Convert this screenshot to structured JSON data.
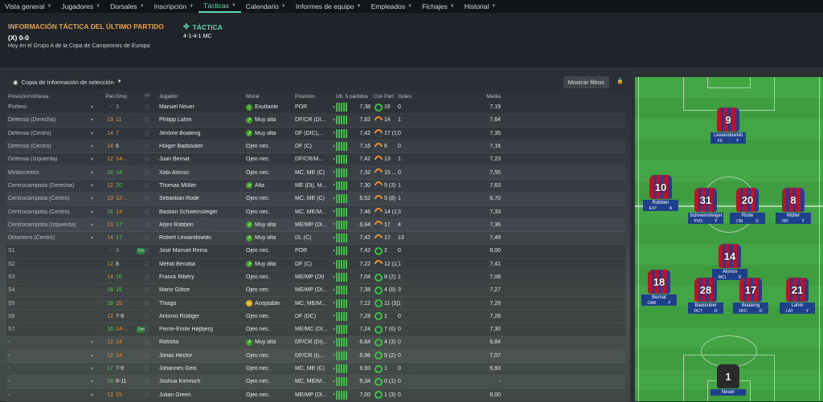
{
  "menu": [
    "Vista general",
    "Jugadores",
    "Dorsales",
    "Inscripción",
    "Tácticas",
    "Calendario",
    "Informes de equipo",
    "Empleados",
    "Fichajes",
    "Historial"
  ],
  "menu_active": 4,
  "info": {
    "title": "INFORMACIÓN TÁCTICA DEL ÚLTIMO PARTIDO",
    "score": "(X) 0-0",
    "subtitle": "Hoy en el Grupo A de la Copa de Campeones de Europa",
    "tactic_title": "TÁCTICA",
    "formation": "4-1-4-1 MC"
  },
  "toolbar": {
    "view": "Copia de Información de selección",
    "show_filters": "Mostrar filtros"
  },
  "columns": {
    "pos": "Posición/rol/tarea",
    "pas": "Pas",
    "dmq": "Dmq",
    "inf": "Inf",
    "jugador": "Jugador",
    "moral": "Moral",
    "posicion": "Posición",
    "ult5": "Últ. 5 partidos",
    "con": "Con",
    "part": "Part",
    "goles": "Goles",
    "media": "Media"
  },
  "rows": [
    {
      "pos": "Portero",
      "pas": "-",
      "dmq": "3",
      "dmqc": "grey",
      "pasc": "grey",
      "name": "Manuel Neuer",
      "moral": "Exultante",
      "mi": "g",
      "mg": "↑",
      "posn": "POR",
      "bars": [
        5,
        5,
        5,
        5,
        5
      ],
      "ult": "7,38",
      "con": "full",
      "part": "16",
      "goles": "0",
      "media": "7,19"
    },
    {
      "pos": "Defensa (Derecha)",
      "pas": "13",
      "dmq": "11",
      "pasc": "orange",
      "dmqc": "orange",
      "name": "Philipp Lahm",
      "moral": "Muy alta",
      "mi": "g",
      "mg": "↗",
      "posn": "DF/CR (Dl...",
      "bars": [
        5,
        5,
        5,
        5,
        5
      ],
      "ult": "7,82",
      "con": "half",
      "part": "14",
      "goles": "1",
      "media": "7,64"
    },
    {
      "pos": "Defensa (Centro)",
      "pas": "14",
      "dmq": "7",
      "pasc": "orange",
      "dmqc": "orange",
      "name": "Jérôme Boateng",
      "moral": "Muy alta",
      "mi": "g",
      "mg": "↗",
      "posn": "DF (DIC),...",
      "bars": [
        5,
        5,
        5,
        5,
        5
      ],
      "ult": "7,42",
      "con": "half",
      "part": "17 (1)",
      "goles": "0",
      "media": "7,35"
    },
    {
      "pos": "Defensa (Centro)",
      "pas": "14",
      "dmq": "6",
      "pasc": "orange",
      "dmqc": "",
      "name": "Holger Badstuber",
      "moral": "Ojeo nec.",
      "mi": "",
      "mg": "",
      "posn": "DF (C)",
      "bars": [
        5,
        5,
        5,
        5,
        5
      ],
      "ult": "7,16",
      "con": "half",
      "part": "6",
      "goles": "0",
      "media": "7,16"
    },
    {
      "pos": "Defensa (Izquierda)",
      "pas": "12",
      "dmq": "14-...",
      "pasc": "orange",
      "dmqc": "orange",
      "name": "Juan Bernat",
      "moral": "Ojeo nec.",
      "mi": "",
      "mg": "",
      "posn": "DF/CR/M...",
      "bars": [
        5,
        5,
        5,
        5,
        5
      ],
      "ult": "7,42",
      "con": "half",
      "part": "13",
      "goles": "1",
      "media": "7,23"
    },
    {
      "pos": "Mediocentro",
      "pas": "18",
      "dmq": "14",
      "pasc": "green",
      "dmqc": "green",
      "name": "Xabi Alonso",
      "moral": "Ojeo nec.",
      "mi": "",
      "mg": "",
      "posn": "MC, ME (C)",
      "bars": [
        5,
        5,
        5,
        5,
        5
      ],
      "ult": "7,32",
      "con": "half",
      "part": "15 ...",
      "goles": "0",
      "media": "7,55"
    },
    {
      "pos": "Centrocampista (Derecha)",
      "pas": "12",
      "dmq": "20",
      "pasc": "orange",
      "dmqc": "green",
      "name": "Thomas Müller",
      "moral": "Alta",
      "mi": "g",
      "mg": "↗",
      "posn": "ME (Dl), M...",
      "bars": [
        5,
        5,
        5,
        5,
        5
      ],
      "ult": "7,30",
      "con": "half",
      "part": "5 (3)",
      "goles": "1",
      "media": "7,63"
    },
    {
      "pos": "Centrocampista (Centro)",
      "pas": "13",
      "dmq": "12-...",
      "pasc": "orange",
      "dmqc": "orange",
      "name": "Sebastian Rode",
      "moral": "Ojeo nec.",
      "mi": "",
      "mg": "",
      "posn": "MC, ME (C)",
      "bars": [
        5,
        5,
        5,
        5,
        5
      ],
      "ult": "6,52",
      "con": "half",
      "part": "5 (8)",
      "goles": "1",
      "media": "6,70"
    },
    {
      "pos": "Centrocampista (Centro)",
      "pas": "16",
      "dmq": "13",
      "pasc": "green",
      "dmqc": "orange",
      "name": "Bastian Schweinsteiger",
      "moral": "Ojeo nec.",
      "mi": "",
      "mg": "",
      "posn": "MC, ME/M...",
      "bars": [
        5,
        5,
        5,
        5,
        5
      ],
      "ult": "7,46",
      "con": "half",
      "part": "14 (1)",
      "goles": "3",
      "media": "7,33"
    },
    {
      "pos": "Centrocampista (Izquierda)",
      "pas": "13",
      "dmq": "17",
      "pasc": "orange",
      "dmqc": "green",
      "name": "Arjen Robben",
      "moral": "Muy alta",
      "mi": "g",
      "mg": "↗",
      "posn": "ME/MP (Dl...",
      "bars": [
        5,
        5,
        5,
        5,
        5
      ],
      "ult": "6,94",
      "con": "half",
      "part": "17",
      "goles": "4",
      "media": "7,36"
    },
    {
      "pos": "Delantero (Centro)",
      "pas": "14",
      "dmq": "17",
      "pasc": "orange",
      "dmqc": "green",
      "name": "Robert Lewandowski",
      "moral": "Muy alta",
      "mi": "g",
      "mg": "↗",
      "posn": "DL (C)",
      "bars": [
        5,
        5,
        5,
        5,
        5
      ],
      "ult": "7,42",
      "con": "half",
      "part": "17",
      "goles": "13",
      "media": "7,49"
    },
    {
      "pos": "S1",
      "pas": "-",
      "dmq": "3",
      "pasc": "grey",
      "dmqc": "grey",
      "den": true,
      "name": "José Manuel Reina",
      "moral": "Ojeo nec.",
      "mi": "",
      "mg": "",
      "posn": "POR",
      "bars": [
        5,
        5,
        5,
        5,
        5
      ],
      "ult": "7,42",
      "con": "full",
      "part": "2",
      "goles": "0",
      "media": "8,00"
    },
    {
      "pos": "S2",
      "pas": "12",
      "dmq": "8",
      "pasc": "orange",
      "dmqc": "",
      "name": "Mehdi Benatia",
      "moral": "Muy alta",
      "mi": "g",
      "mg": "↗",
      "posn": "DF (C)",
      "bars": [
        5,
        5,
        5,
        5,
        5
      ],
      "ult": "7,22",
      "con": "half",
      "part": "12 (1)",
      "goles": "1",
      "media": "7,41"
    },
    {
      "pos": "S3",
      "pas": "14",
      "dmq": "16",
      "pasc": "orange",
      "dmqc": "green",
      "name": "Franck Ribéry",
      "moral": "Ojeo nec.",
      "mi": "",
      "mg": "",
      "posn": "ME/MP (DI)",
      "bars": [
        5,
        5,
        5,
        5,
        5
      ],
      "ult": "7,04",
      "con": "full",
      "part": "8 (2)",
      "goles": "1",
      "media": "7,08"
    },
    {
      "pos": "S4",
      "pas": "18",
      "dmq": "15",
      "pasc": "green",
      "dmqc": "green",
      "name": "Mario Götze",
      "moral": "Ojeo nec.",
      "mi": "",
      "mg": "",
      "posn": "ME/MP (DI...",
      "bars": [
        5,
        5,
        5,
        5,
        5
      ],
      "ult": "7,38",
      "con": "full",
      "part": "4 (8)",
      "goles": "3",
      "media": "7,27"
    },
    {
      "pos": "S5",
      "pas": "18",
      "dmq": "15",
      "pasc": "green",
      "dmqc": "orange",
      "name": "Thiago",
      "moral": "Aceptable",
      "mi": "y",
      "mg": "→",
      "posn": "MC, ME/M...",
      "bars": [
        5,
        5,
        5,
        5,
        5
      ],
      "ult": "7,12",
      "con": "full",
      "part": "11 (3)",
      "goles": "1",
      "media": "7,28"
    },
    {
      "pos": "S6",
      "pas": "12",
      "dmq": "7-9",
      "pasc": "orange",
      "dmqc": "",
      "name": "Antonio Rüdiger",
      "moral": "Ojeo nec.",
      "mi": "",
      "mg": "",
      "posn": "DF (DC)",
      "bars": [
        5,
        5,
        5,
        5,
        5
      ],
      "ult": "7,28",
      "con": "full",
      "part": "1",
      "goles": "0",
      "media": "7,28"
    },
    {
      "pos": "S7",
      "pas": "16",
      "dmq": "14-...",
      "pasc": "green",
      "dmqc": "orange",
      "den": true,
      "name": "Pierre-Emile Højbjerg",
      "moral": "Ojeo nec.",
      "mi": "",
      "mg": "",
      "posn": "ME/MC (Dl...",
      "bars": [
        5,
        5,
        5,
        5,
        5
      ],
      "ult": "7,24",
      "con": "full",
      "part": "7 (6)",
      "goles": "0",
      "media": "7,30"
    },
    {
      "pos": "-",
      "pas": "12",
      "dmq": "14",
      "pasc": "orange",
      "dmqc": "orange",
      "name": "Rafinha",
      "moral": "Muy alta",
      "mi": "g",
      "mg": "↗",
      "posn": "DF/CR (Dl)...",
      "bars": [
        5,
        5,
        5,
        5,
        5
      ],
      "ult": "6,84",
      "con": "full",
      "part": "4 (3)",
      "goles": "0",
      "media": "6,84"
    },
    {
      "pos": "-",
      "pas": "12",
      "dmq": "14",
      "pasc": "orange",
      "dmqc": "orange",
      "name": "Jonas Hector",
      "moral": "Ojeo nec.",
      "mi": "",
      "mg": "",
      "posn": "DF/CR (I),...",
      "bars": [
        5,
        5,
        5,
        5,
        5
      ],
      "ult": "6,96",
      "con": "full",
      "part": "5 (2)",
      "goles": "0",
      "media": "7,07"
    },
    {
      "pos": "-",
      "pas": "17",
      "dmq": "7-9",
      "pasc": "green",
      "dmqc": "",
      "name": "Johannes Geis",
      "moral": "Ojeo nec.",
      "mi": "",
      "mg": "",
      "posn": "MC, ME (C)",
      "bars": [
        5,
        5,
        5,
        5,
        5
      ],
      "ult": "6,93",
      "con": "full",
      "part": "1",
      "goles": "0",
      "media": "6,93"
    },
    {
      "pos": "-",
      "pas": "16",
      "dmq": "8-11",
      "pasc": "green",
      "dmqc": "",
      "name": "Joshua Kimmich",
      "moral": "Ojeo nec.",
      "mi": "",
      "mg": "",
      "posn": "MC, ME/M...",
      "bars": [
        5,
        5,
        5,
        5,
        5
      ],
      "ult": "6,34",
      "con": "full",
      "part": "0 (1)",
      "goles": "0",
      "media": "-"
    },
    {
      "pos": "-",
      "pas": "13",
      "dmq": "15",
      "pasc": "orange",
      "dmqc": "orange",
      "name": "Julian Green",
      "moral": "Ojeo nec.",
      "mi": "",
      "mg": "",
      "posn": "ME/MP (Dl...",
      "bars": [
        5,
        5,
        5,
        5,
        5
      ],
      "ult": "7,00",
      "con": "full",
      "part": "1 (3)",
      "goles": "0",
      "media": "8,00"
    }
  ],
  "pitch": [
    {
      "num": "9",
      "name": "Lewandowski",
      "role": "F9",
      "duty": "Y"
    },
    {
      "num": "10",
      "name": "Robben",
      "role": "EXT",
      "duty": "A"
    },
    {
      "num": "31",
      "name": "Schweinsteiger",
      "role": "PVO",
      "duty": "Y"
    },
    {
      "num": "20",
      "name": "Rode",
      "role": "CM",
      "duty": "D"
    },
    {
      "num": "8",
      "name": "Müller",
      "role": "INT",
      "duty": "Y"
    },
    {
      "num": "14",
      "name": "Alonso",
      "role": "MCI",
      "duty": "D"
    },
    {
      "num": "18",
      "name": "Bernat",
      "role": "CAR",
      "duty": "Y"
    },
    {
      "num": "28",
      "name": "Badstuber",
      "role": "DCT",
      "duty": "D"
    },
    {
      "num": "17",
      "name": "Boateng",
      "role": "DFC",
      "duty": "D"
    },
    {
      "num": "21",
      "name": "Lahm",
      "role": "LAT",
      "duty": "Y"
    },
    {
      "num": "1",
      "name": "Neuer",
      "role": "",
      "duty": ""
    }
  ]
}
